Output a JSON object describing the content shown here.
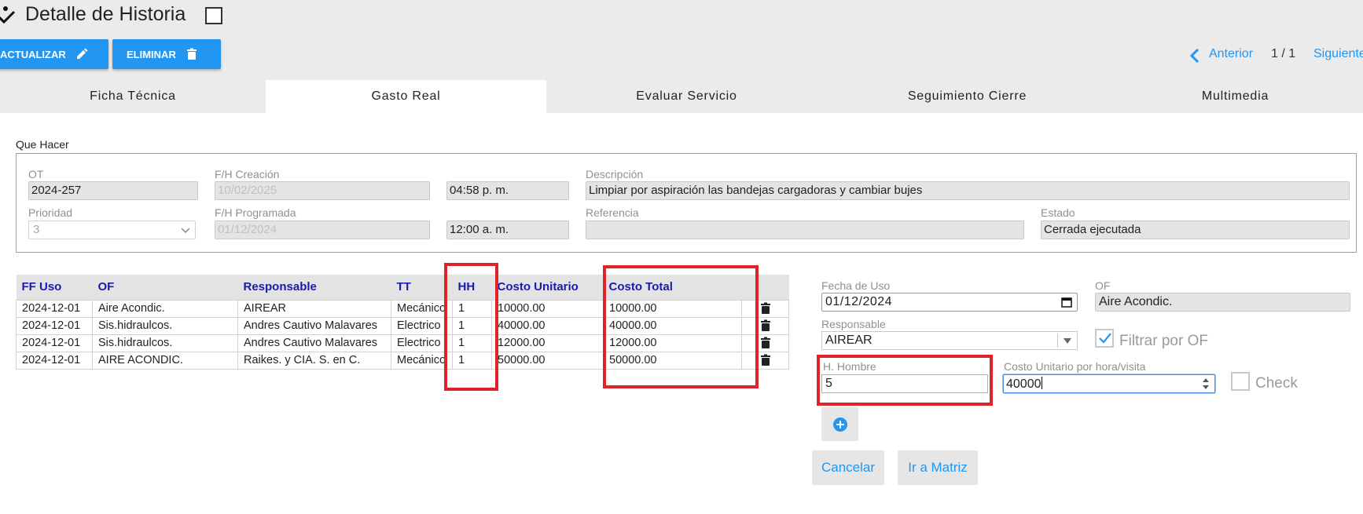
{
  "header": {
    "title": "Detalle de Historia",
    "update_label": "ACTUALIZAR",
    "delete_label": "ELIMINAR",
    "pager": {
      "prev_label": "Anterior",
      "count": "1 / 1",
      "next_label": "Siguiente"
    }
  },
  "tabs": [
    {
      "label": "Ficha Técnica",
      "active": false
    },
    {
      "label": "Gasto Real",
      "active": true
    },
    {
      "label": "Evaluar Servicio",
      "active": false
    },
    {
      "label": "Seguimiento Cierre",
      "active": false
    },
    {
      "label": "Multimedia",
      "active": false
    }
  ],
  "que_hacer": {
    "legend": "Que Hacer",
    "ot": {
      "label": "OT",
      "value": "2024-257"
    },
    "creacion": {
      "label": "F/H Creación",
      "date": "10/02/2025",
      "time": "04:58  p. m."
    },
    "descripcion": {
      "label": "Descripción",
      "value": "Limpiar por aspiración las bandejas cargadoras y cambiar bujes"
    },
    "prioridad": {
      "label": "Prioridad",
      "value": "3"
    },
    "programada": {
      "label": "F/H Programada",
      "date": "01/12/2024",
      "time": "12:00  a. m."
    },
    "referencia": {
      "label": "Referencia",
      "value": ""
    },
    "estado": {
      "label": "Estado",
      "value": "Cerrada ejecutada"
    }
  },
  "table": {
    "columns": [
      "FF Uso",
      "OF",
      "Responsable",
      "TT",
      "HH",
      "Costo Unitario",
      "Costo Total"
    ],
    "rows": [
      [
        "2024-12-01",
        "Aire Acondic.",
        "AIREAR",
        "Mecánico",
        "1",
        "10000.00",
        "10000.00"
      ],
      [
        "2024-12-01",
        "Sis.hidraulcos.",
        "Andres Cautivo Malavares",
        "Electrico",
        "1",
        "40000.00",
        "40000.00"
      ],
      [
        "2024-12-01",
        "Sis.hidraulcos.",
        "Andres Cautivo Malavares",
        "Electrico",
        "1",
        "12000.00",
        "12000.00"
      ],
      [
        "2024-12-01",
        "AIRE ACONDIC.",
        "Raikes. y CIA. S. en C.",
        "Mecánico",
        "1",
        "50000.00",
        "50000.00"
      ]
    ]
  },
  "form": {
    "fecha_label": "Fecha de Uso",
    "fecha_value": "01/12/2024",
    "of_label": "OF",
    "of_value": "Aire Acondic.",
    "responsable_label": "Responsable",
    "responsable_value": "AIREAR",
    "filtrar_label": "Filtrar por OF",
    "filtrar_checked": true,
    "hh_label": "H. Hombre",
    "hh_value": "5",
    "costo_label": "Costo Unitario por hora/visita",
    "costo_value": "40000",
    "check_label": "Check",
    "check_checked": false,
    "cancel_label": "Cancelar",
    "matrix_label": "Ir a Matriz"
  },
  "colors": {
    "accent": "#2196f3",
    "header_text": "#1a1ab0",
    "highlight": "#e0222b"
  }
}
